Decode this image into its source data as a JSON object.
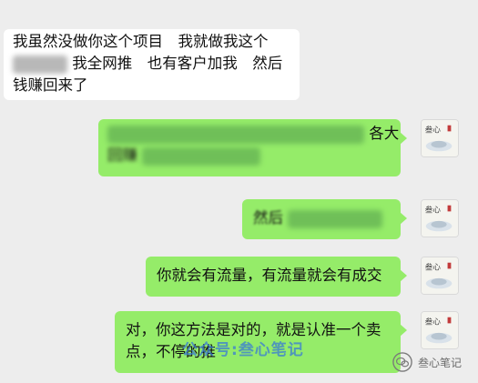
{
  "messages": [
    {
      "side": "left",
      "line1": "我虽然没做你这个项目　我就做我这个",
      "line2_tail": "我全网推　也有客户加我　然后",
      "line3": "钱赚回来了"
    },
    {
      "side": "right",
      "visible_tail_1": "各大",
      "visible_fragment_2": "回赚"
    },
    {
      "side": "right",
      "visible_head": "然后"
    },
    {
      "side": "right",
      "text": "你就会有流量，有流量就会有成交"
    },
    {
      "side": "right",
      "line1": "对，你这方法是对的，就是认准一个卖",
      "line2": "点，不停的推"
    }
  ],
  "watermark": "公众号:叁心笔记",
  "brand_name": "叁心笔记",
  "colors": {
    "background": "#ededed",
    "outgoing": "#95ec69",
    "incoming": "#ffffff",
    "watermark": "#3a7bd5"
  }
}
